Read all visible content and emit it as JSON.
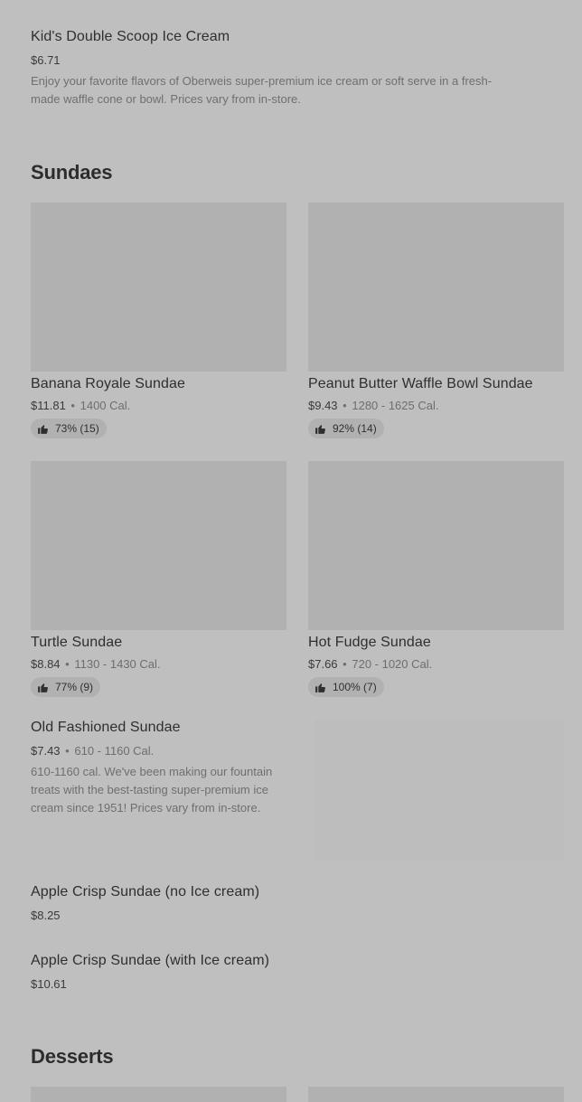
{
  "items_top": {
    "kids": {
      "title": "Kid's Double Scoop Ice Cream",
      "price": "$6.71",
      "desc_line1": "Enjoy your favorite flavors of Oberweis super-premium ice cream or soft serve in a fresh-",
      "desc_line2": "made waffle cone or bowl. Prices vary from in-store."
    }
  },
  "sections": {
    "sundaes": "Sundaes",
    "desserts": "Desserts"
  },
  "sundaes": [
    {
      "title": "Banana Royale Sundae",
      "price": "$11.81",
      "cal": "1400 Cal.",
      "rating": "73% (15)"
    },
    {
      "title": "Peanut Butter Waffle Bowl Sundae",
      "price": "$9.43",
      "cal": "1280 - 1625 Cal.",
      "rating": "92% (14)"
    },
    {
      "title": "Turtle Sundae",
      "price": "$8.84",
      "cal": "1130 - 1430 Cal.",
      "rating": "77% (9)"
    },
    {
      "title": "Hot Fudge Sundae",
      "price": "$7.66",
      "cal": "720 - 1020 Cal.",
      "rating": "100% (7)"
    }
  ],
  "old_fashioned": {
    "title": "Old Fashioned Sundae",
    "price": "$7.43",
    "cal": "610 - 1160 Cal.",
    "desc_line1": "610-1160 cal. We've been making our fountain",
    "desc_line2": "treats with the best-tasting super-premium ice",
    "desc_line3": "cream since 1951! Prices vary from in-store."
  },
  "apple_no": {
    "title": "Apple Crisp Sundae (no Ice cream)",
    "price": "$8.25"
  },
  "apple_with": {
    "title": "Apple Crisp Sundae (with Ice cream)",
    "price": "$10.61"
  },
  "separator": "•",
  "icons": {
    "rating": "thumbs-up-icon"
  }
}
